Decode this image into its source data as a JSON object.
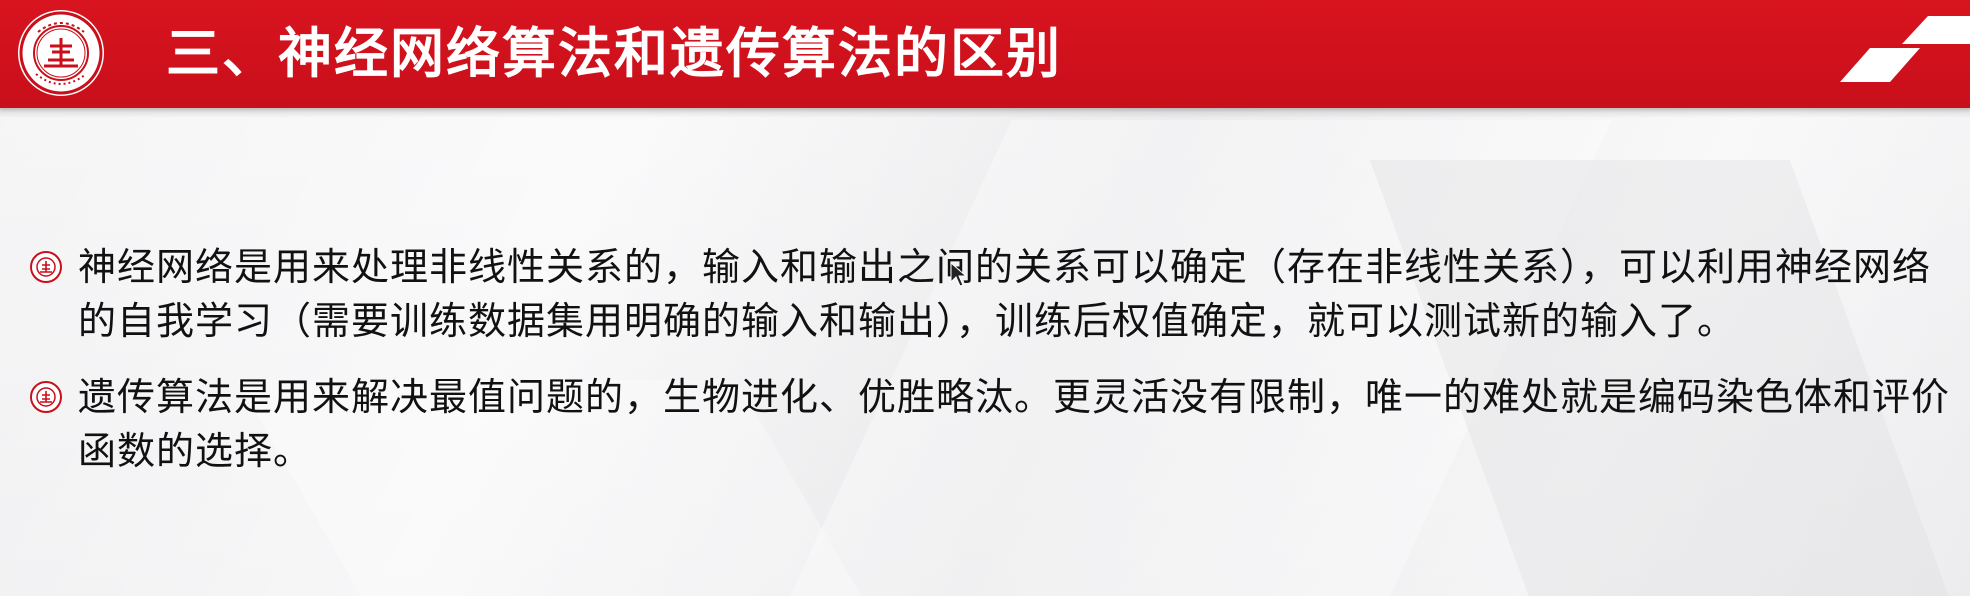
{
  "header": {
    "title": "三、神经网络算法和遗传算法的区别",
    "logo_icon": "university-seal-icon",
    "corner_decoration": "white-checker-pattern",
    "bar_color": "#cf121d"
  },
  "bullets": [
    {
      "icon": "university-seal-bullet-icon",
      "text": "神经网络是用来处理非线性关系的，输入和输出之间的关系可以确定（存在非线性关系），可以利用神经网络的自我学习（需要训练数据集用明确的输入和输出），训练后权值确定，就可以测试新的输入了。"
    },
    {
      "icon": "university-seal-bullet-icon",
      "text": "遗传算法是用来解决最值问题的，生物进化、优胜略汰。更灵活没有限制，唯一的难处就是编码染色体和评价函数的选择。"
    }
  ]
}
